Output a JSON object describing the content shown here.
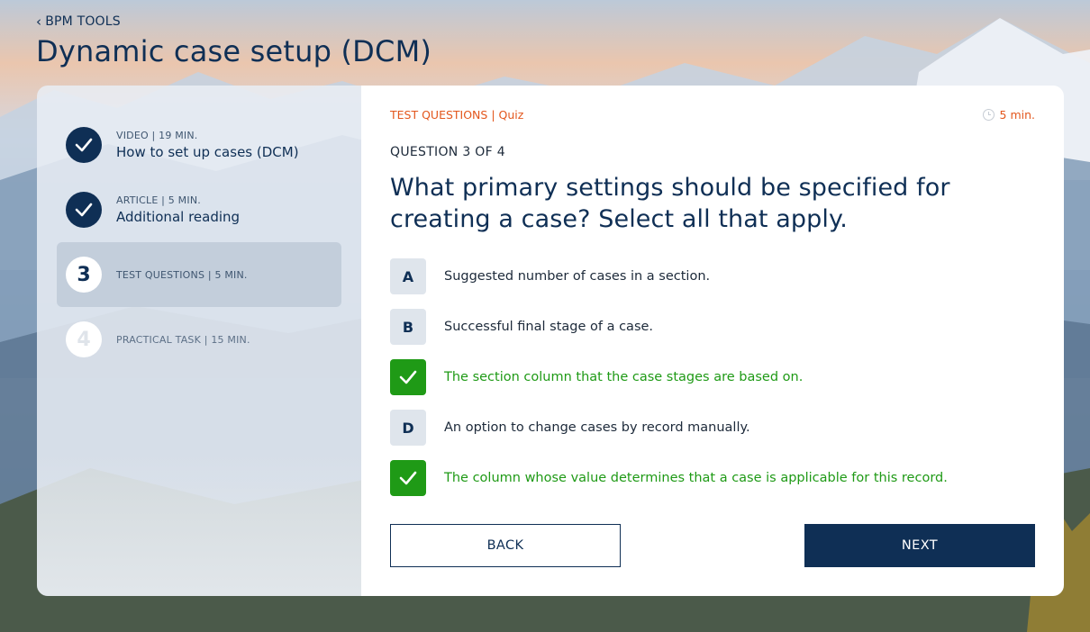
{
  "nav": {
    "back_label": "BPM TOOLS"
  },
  "page": {
    "title": "Dynamic case setup (DCM)"
  },
  "sidebar": {
    "steps": [
      {
        "meta": "VIDEO | 19 MIN.",
        "title": "How to set up cases (DCM)",
        "status": "done",
        "icon": "check-icon"
      },
      {
        "meta": "ARTICLE | 5 MIN.",
        "title": "Additional reading",
        "status": "done",
        "icon": "check-icon"
      },
      {
        "number": "3",
        "meta": "TEST QUESTIONS | 5 MIN.",
        "status": "current"
      },
      {
        "number": "4",
        "meta": "PRACTICAL TASK | 15 MIN.",
        "status": "pending"
      }
    ]
  },
  "main": {
    "section_label": "TEST QUESTIONS | Quiz",
    "duration": "5 min.",
    "question_counter": "QUESTION 3 OF 4",
    "question": "What primary settings should be specified for creating a case? Select all that apply.",
    "options": [
      {
        "letter": "A",
        "text": "Suggested number of cases in a section.",
        "selected": false
      },
      {
        "letter": "B",
        "text": "Successful final stage of a case.",
        "selected": false
      },
      {
        "letter": "C",
        "text": "The section column that the case stages are based on.",
        "selected": true
      },
      {
        "letter": "D",
        "text": "An option to change cases by record manually.",
        "selected": false
      },
      {
        "letter": "E",
        "text": "The column whose value determines that a case is applicable for this record.",
        "selected": true
      }
    ],
    "back_button": "BACK",
    "next_button": "NEXT"
  },
  "colors": {
    "navy": "#0f2f55",
    "accent_orange": "#e3571d",
    "selected_green": "#1f9a16",
    "active_step_bg": "#c3cedb"
  }
}
